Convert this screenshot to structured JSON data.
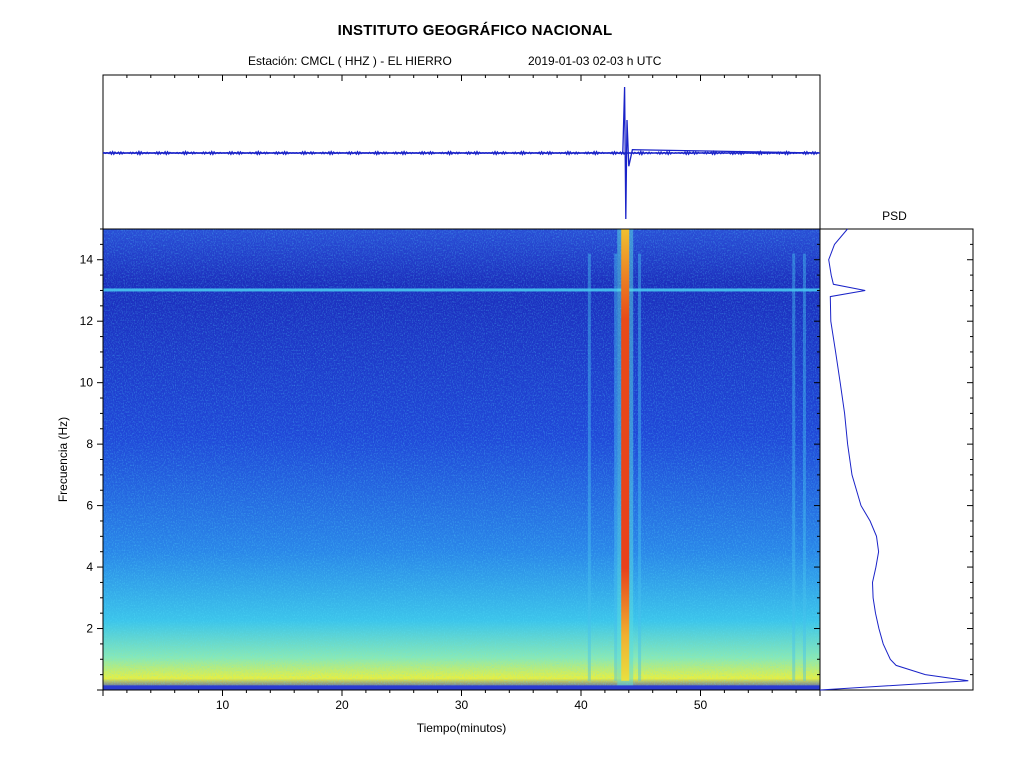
{
  "header": {
    "title": "INSTITUTO GEOGRÁFICO NACIONAL",
    "station_line": "Estación:  CMCL ( HHZ ) - EL HIERRO",
    "date_line": "2019-01-03  02-03 h UTC"
  },
  "chart_data": [
    {
      "type": "line",
      "name": "seismogram",
      "xlim": [
        0,
        60
      ],
      "event_time_min": 43.7,
      "series": [
        {
          "x": [
            0,
            43.5,
            43.65,
            43.75,
            43.85,
            44.0,
            44.3,
            60
          ],
          "y": [
            0,
            0,
            1.0,
            -1.0,
            0.5,
            -0.2,
            0.05,
            0
          ]
        }
      ],
      "color": "#1a23c8"
    },
    {
      "type": "heatmap",
      "name": "spectrogram",
      "xlabel": "Tiempo(minutos)",
      "ylabel": "Frecuencia  (Hz)",
      "xlim": [
        0,
        60
      ],
      "ylim": [
        0,
        15
      ],
      "xticks": [
        10,
        20,
        30,
        40,
        50
      ],
      "yticks": [
        2,
        4,
        6,
        8,
        10,
        12,
        14
      ],
      "noise_line_hz": 13,
      "event_time_min": 43.7,
      "colorscale": [
        "#1e1eb4",
        "#1f4fe0",
        "#22a6f0",
        "#4fe0e6",
        "#e6f03c",
        "#f0a01e",
        "#e62814"
      ]
    },
    {
      "type": "line",
      "name": "psd",
      "title": "PSD",
      "ylim": [
        0,
        15
      ],
      "series": [
        {
          "freq": [
            0.0,
            0.3,
            0.5,
            0.8,
            1.0,
            1.5,
            2.0,
            2.5,
            3.0,
            3.5,
            4.0,
            4.5,
            5.0,
            5.5,
            6.0,
            7.0,
            8.0,
            9.0,
            10.0,
            11.0,
            12.0,
            12.8,
            13.0,
            13.2,
            13.5,
            14.0,
            14.5,
            15.0
          ],
          "level": [
            0.0,
            0.98,
            0.7,
            0.5,
            0.45,
            0.4,
            0.38,
            0.37,
            0.36,
            0.35,
            0.36,
            0.37,
            0.36,
            0.33,
            0.28,
            0.22,
            0.18,
            0.15,
            0.12,
            0.1,
            0.08,
            0.08,
            0.3,
            0.08,
            0.06,
            0.05,
            0.1,
            0.18
          ]
        }
      ],
      "color": "#1a23c8"
    }
  ]
}
